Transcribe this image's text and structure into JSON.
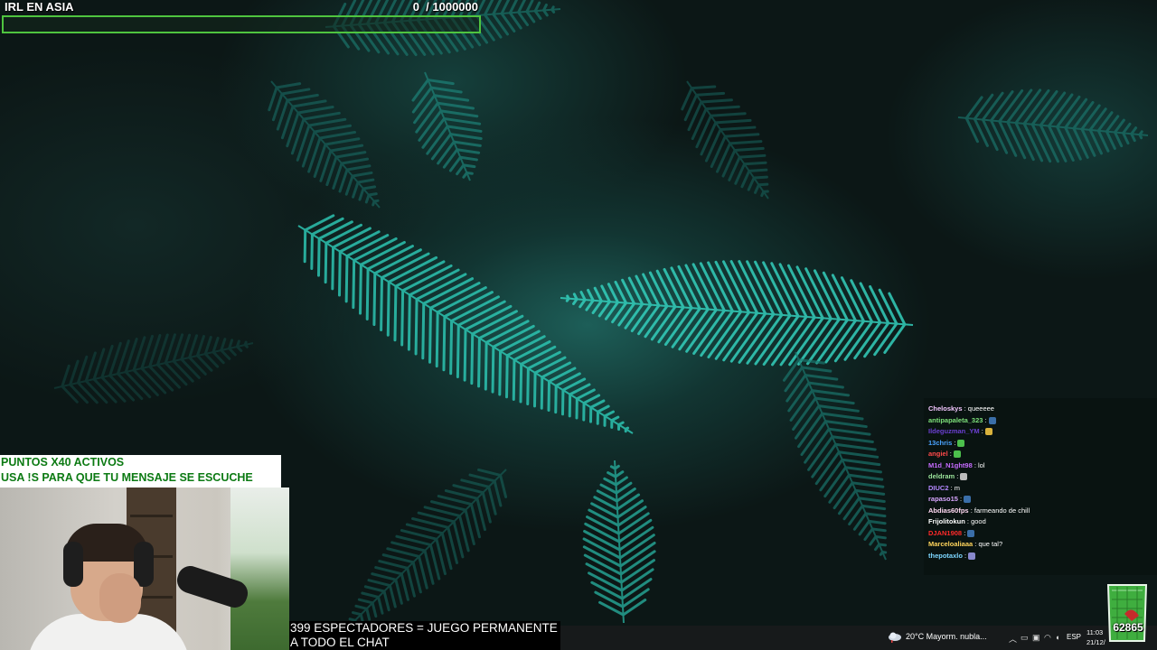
{
  "goal": {
    "title": "IRL EN ASIA",
    "count": "0  / 1000000",
    "progress_fraction": 0
  },
  "banner": {
    "line1": "PUNTOS X40 ACTIVOS",
    "line2": "USA !S PARA QUE TU MENSAJE SE ESCUCHE"
  },
  "caption": {
    "line1": "399 ESPECTADORES = JUEGO PERMANENTE",
    "line2": "A TODO EL CHAT"
  },
  "chat": {
    "messages": [
      {
        "user": "Cheloskys",
        "text": ": queeeee",
        "color": "#f3c7ff"
      },
      {
        "user": "antipapaleta_323",
        "text": ":",
        "color": "#7de07a",
        "emote": "#3a6ea8"
      },
      {
        "user": "Ildeguzman_YM",
        "text": ":",
        "color": "#6a3fd0",
        "emote": "#d9b23c"
      },
      {
        "user": "13chris",
        "text": ":",
        "color": "#4aa3ff",
        "emote": "#4cbf4c"
      },
      {
        "user": "angiel",
        "text": ":",
        "color": "#ff4a4a",
        "emote": "#4cbf4c"
      },
      {
        "user": "M1d_N1ght98",
        "text": ": lol",
        "color": "#c66bff"
      },
      {
        "user": "deldram",
        "text": ":",
        "color": "#9be39b",
        "emote": "#bbbbbb"
      },
      {
        "user": "DIUC2",
        "text": ": m",
        "color": "#b488ff"
      },
      {
        "user": "rapaso15",
        "text": ":",
        "color": "#d9a6ff",
        "emote": "#3a6ea8"
      },
      {
        "user": "Abdias60fps",
        "text": ": farmeando de chill",
        "color": "#ffd8f2"
      },
      {
        "user": "Frijolitokun",
        "text": ": good",
        "color": "#ffffff"
      },
      {
        "user": "DJAN1908",
        "text": ":",
        "color": "#ff2a2a",
        "emote": "#3a6ea8"
      },
      {
        "user": "Marceloaliaaa",
        "text": ": que tal?",
        "color": "#ffd45c"
      },
      {
        "user": "thepotaxlo",
        "text": ":",
        "color": "#7dd6ff",
        "emote": "#8888cc"
      }
    ]
  },
  "taskbar": {
    "weather": "20°C  Mayorm. nubla...",
    "language": "ESP",
    "time": "11:03",
    "date": "21/12/"
  },
  "subgoal": {
    "count": "62865"
  }
}
